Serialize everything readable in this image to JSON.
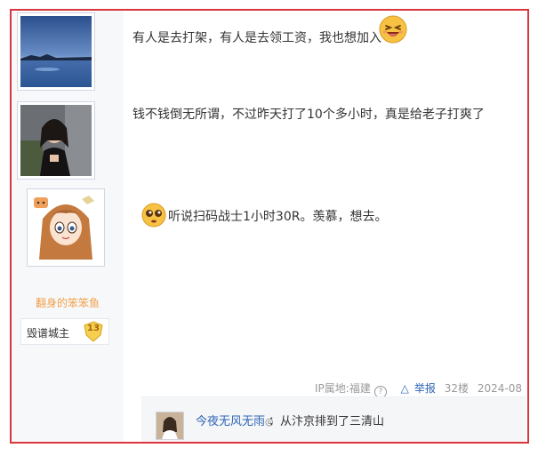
{
  "posts": [
    {
      "text": "有人是去打架，有人是去领工资，我也想加入",
      "emoji_name": "laughing-emoji",
      "avatar_name": "avatar-lake-landscape"
    },
    {
      "text": "钱不钱倒无所谓，不过昨天打了10个多小时，真是给老子打爽了",
      "avatar_name": "avatar-portrait-woman"
    },
    {
      "text": "听说扫码战士1小时30R。羡慕，想去。",
      "emoji_name": "pleading-emoji",
      "avatar_name": "avatar-anime-girl",
      "username": "翻身的笨笨鱼",
      "rank_title": "毁谱城主",
      "level": "13"
    }
  ],
  "meta": {
    "ip_location": "IP属地:福建",
    "report_label": "举报",
    "floor": "32楼",
    "date": "2024-08"
  },
  "reply": {
    "user": "今夜无风无雨",
    "text": "：从汴京排到了三清山",
    "badge": "◎"
  },
  "colors": {
    "frame_border": "#d9363e",
    "username_orange": "#f0a04b",
    "link_blue": "#2d64b3"
  }
}
